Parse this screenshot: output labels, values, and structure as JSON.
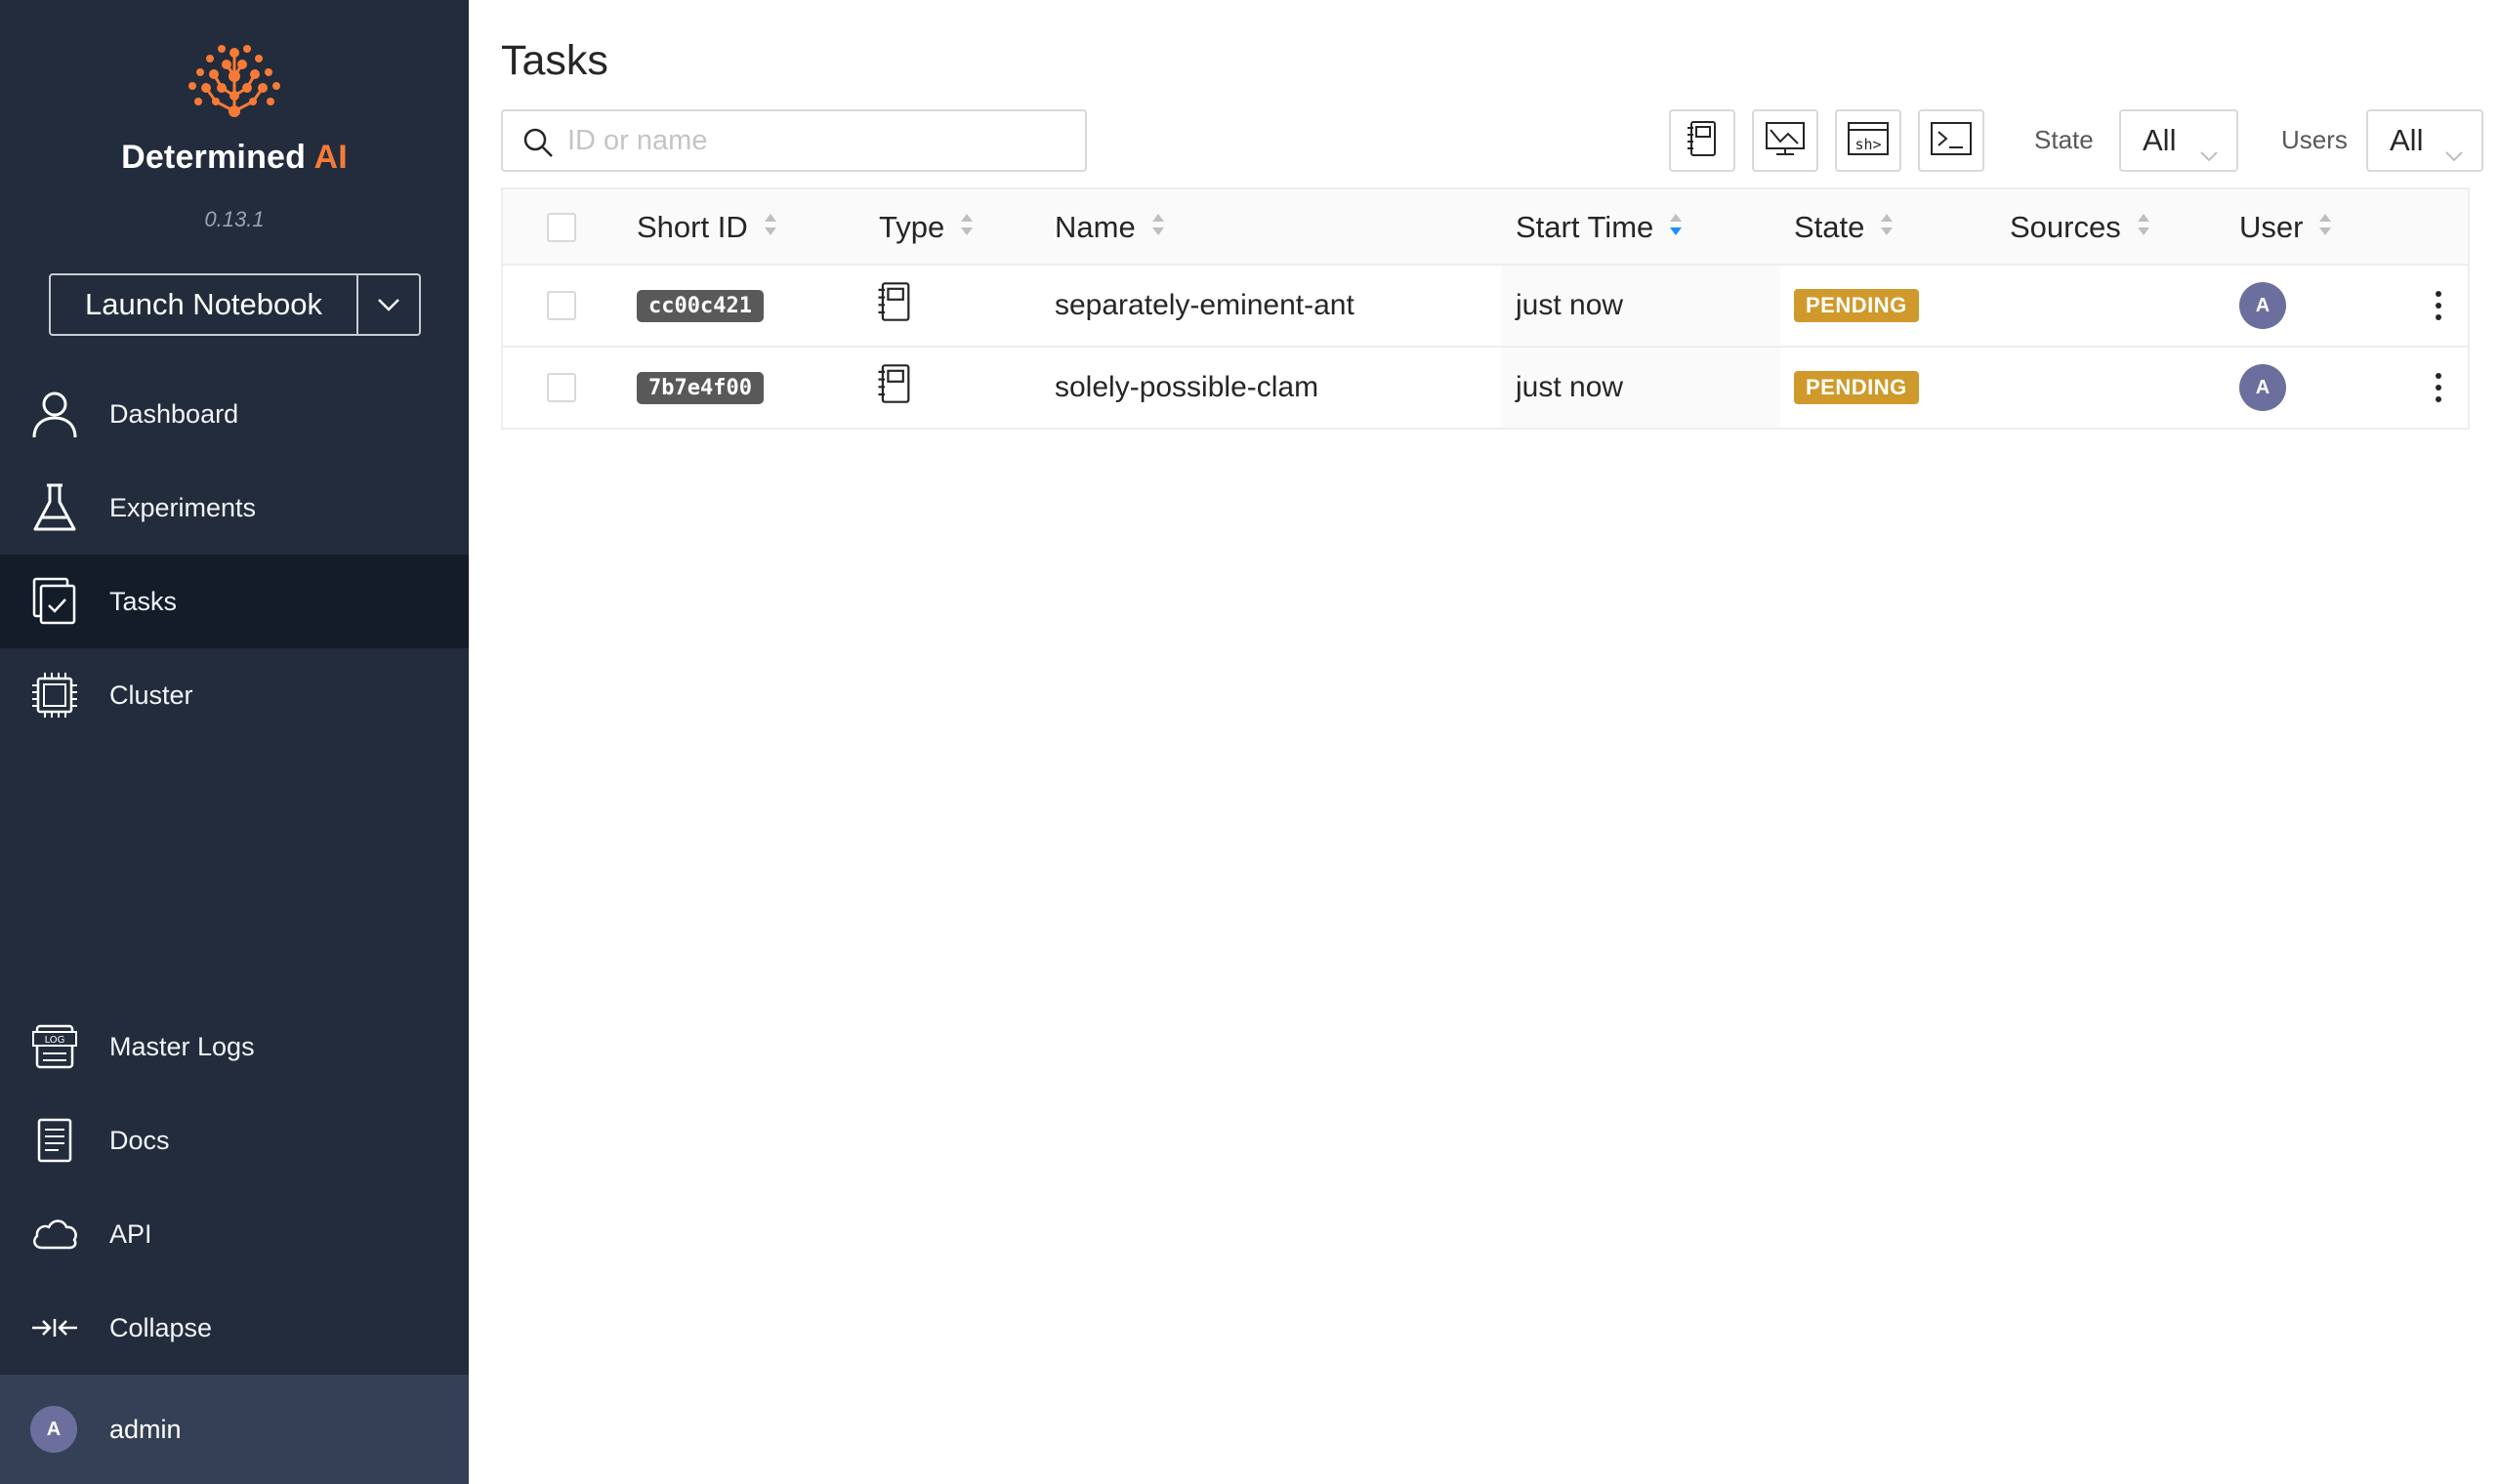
{
  "sidebar": {
    "brand": {
      "name": "Determined",
      "suffix": "AI"
    },
    "version": "0.13.1",
    "launch_label": "Launch Notebook",
    "nav_top": [
      {
        "label": "Dashboard",
        "icon": "user-icon"
      },
      {
        "label": "Experiments",
        "icon": "flask-icon"
      },
      {
        "label": "Tasks",
        "icon": "tasks-icon",
        "active": true
      },
      {
        "label": "Cluster",
        "icon": "chip-icon"
      }
    ],
    "nav_bottom": [
      {
        "label": "Master Logs",
        "icon": "log-icon"
      },
      {
        "label": "Docs",
        "icon": "docs-icon"
      },
      {
        "label": "API",
        "icon": "cloud-icon"
      },
      {
        "label": "Collapse",
        "icon": "collapse-icon"
      }
    ],
    "user": {
      "initial": "A",
      "name": "admin"
    }
  },
  "main": {
    "title": "Tasks",
    "search": {
      "placeholder": "ID or name",
      "value": ""
    },
    "type_filters": [
      "notebook-icon",
      "tensorboard-icon",
      "shell-icon",
      "command-icon"
    ],
    "filters": {
      "state_label": "State",
      "state_value": "All",
      "users_label": "Users",
      "users_value": "All"
    },
    "table": {
      "columns": [
        "Short ID",
        "Type",
        "Name",
        "Start Time",
        "State",
        "Sources",
        "User"
      ],
      "sorted_column": "Start Time",
      "rows": [
        {
          "short_id": "cc00c421",
          "type": "notebook",
          "name": "separately-eminent-ant",
          "start_time": "just now",
          "state": "PENDING",
          "sources": "",
          "user_initial": "A"
        },
        {
          "short_id": "7b7e4f00",
          "type": "notebook",
          "name": "solely-possible-clam",
          "start_time": "just now",
          "state": "PENDING",
          "sources": "",
          "user_initial": "A"
        }
      ]
    }
  },
  "colors": {
    "sidebar_bg": "#222c3c",
    "sidebar_active": "#141c2a",
    "brand_orange": "#f77b36",
    "pending": "#cf9a2b",
    "avatar": "#6c6f9e",
    "sort_active": "#1890ff"
  }
}
